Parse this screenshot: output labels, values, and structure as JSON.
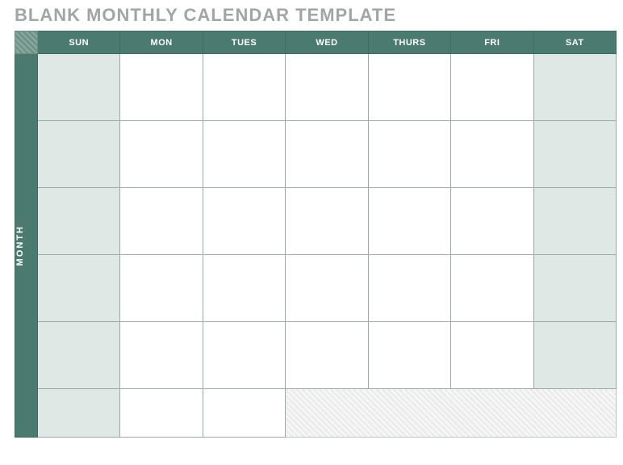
{
  "title": "BLANK MONTHLY CALENDAR TEMPLATE",
  "monthLabel": "MONTH",
  "days": [
    "SUN",
    "MON",
    "TUES",
    "WED",
    "THURS",
    "FRI",
    "SAT"
  ],
  "rows": 5,
  "colors": {
    "header": "#4b7a70",
    "weekend": "#dfe8e4",
    "title": "#a0a6a5"
  }
}
